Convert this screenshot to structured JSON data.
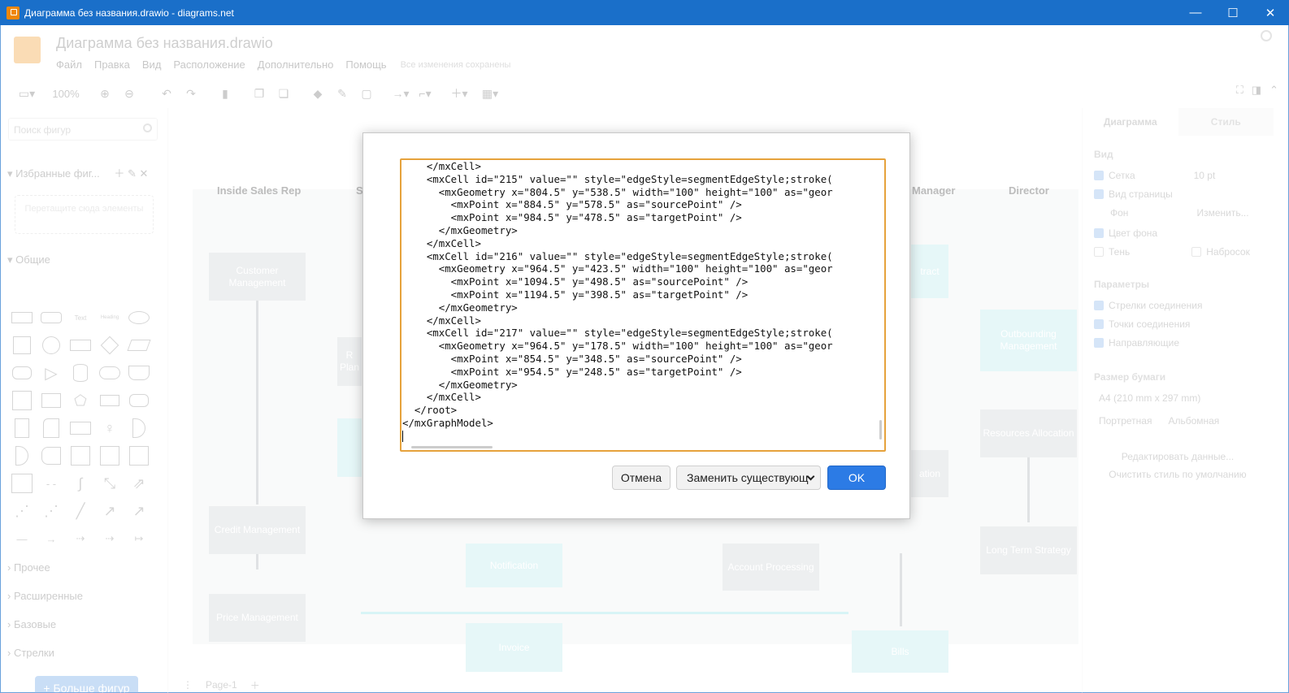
{
  "window": {
    "title": "Диаграмма без названия.drawio - diagrams.net",
    "minimize": "—",
    "maximize": "☐",
    "close": "✕"
  },
  "app": {
    "doc_title": "Диаграмма без названия.drawio",
    "menu": [
      "Файл",
      "Правка",
      "Вид",
      "Расположение",
      "Дополнительно",
      "Помощь"
    ],
    "saved_status": "Все изменения сохранены",
    "zoom": "100%"
  },
  "sidebar": {
    "search_placeholder": "Поиск фигур",
    "favorites": "Избранные фиг...",
    "drop_hint": "Перетащите сюда элементы",
    "general": "Общие",
    "sections": [
      "Прочее",
      "Расширенные",
      "Базовые",
      "Стрелки"
    ],
    "more_shapes": "+ Больше фигур"
  },
  "canvas": {
    "lanes": [
      "Inside Sales Rep",
      "S",
      "Manager",
      "Director"
    ],
    "nodes": {
      "customer_management": "Customer Management",
      "credit_management": "Credit Management",
      "price_management": "Price Management",
      "notification": "Notification",
      "invoice": "Invoice",
      "account_processing": "Account Processing",
      "bills": "Bills",
      "outbounding_management": "Outbounding Management",
      "resources_allocation": "Resources Allocation",
      "long_term_strategy": "Long Term Strategy",
      "contract": "tract",
      "r_plan": "R Plan",
      "ation": "ation"
    },
    "page_tab": "Page-1"
  },
  "format_panel": {
    "tabs": [
      "Диаграмма",
      "Стиль"
    ],
    "view_title": "Вид",
    "grid": "Сетка",
    "grid_size": "10 pt",
    "page_view": "Вид страницы",
    "background": "Фон",
    "change_btn": "Изменить...",
    "bg_color": "Цвет фона",
    "shadow": "Тень",
    "sketch": "Набросок",
    "options_title": "Параметры",
    "connection_arrows": "Стрелки соединения",
    "connection_points": "Точки соединения",
    "guides": "Направляющие",
    "paper_title": "Размер бумаги",
    "paper_size": "A4 (210 mm x 297 mm)",
    "portrait": "Портретная",
    "landscape": "Альбомная",
    "edit_data": "Редактировать данные...",
    "clear_style": "Очистить стиль по умолчанию"
  },
  "dialog": {
    "xml_lines": [
      "    </mxCell>",
      "    <mxCell id=\"215\" value=\"\" style=\"edgeStyle=segmentEdgeStyle;stroke(",
      "      <mxGeometry x=\"804.5\" y=\"538.5\" width=\"100\" height=\"100\" as=\"geor",
      "        <mxPoint x=\"884.5\" y=\"578.5\" as=\"sourcePoint\" />",
      "        <mxPoint x=\"984.5\" y=\"478.5\" as=\"targetPoint\" />",
      "      </mxGeometry>",
      "    </mxCell>",
      "    <mxCell id=\"216\" value=\"\" style=\"edgeStyle=segmentEdgeStyle;stroke(",
      "      <mxGeometry x=\"964.5\" y=\"423.5\" width=\"100\" height=\"100\" as=\"geor",
      "        <mxPoint x=\"1094.5\" y=\"498.5\" as=\"sourcePoint\" />",
      "        <mxPoint x=\"1194.5\" y=\"398.5\" as=\"targetPoint\" />",
      "      </mxGeometry>",
      "    </mxCell>",
      "    <mxCell id=\"217\" value=\"\" style=\"edgeStyle=segmentEdgeStyle;stroke(",
      "      <mxGeometry x=\"964.5\" y=\"178.5\" width=\"100\" height=\"100\" as=\"geor",
      "        <mxPoint x=\"854.5\" y=\"348.5\" as=\"sourcePoint\" />",
      "        <mxPoint x=\"954.5\" y=\"248.5\" as=\"targetPoint\" />",
      "      </mxGeometry>",
      "    </mxCell>",
      "  </root>",
      "</mxGraphModel>"
    ],
    "cancel": "Отмена",
    "replace_select": "Заменить существующ",
    "ok": "OK"
  }
}
